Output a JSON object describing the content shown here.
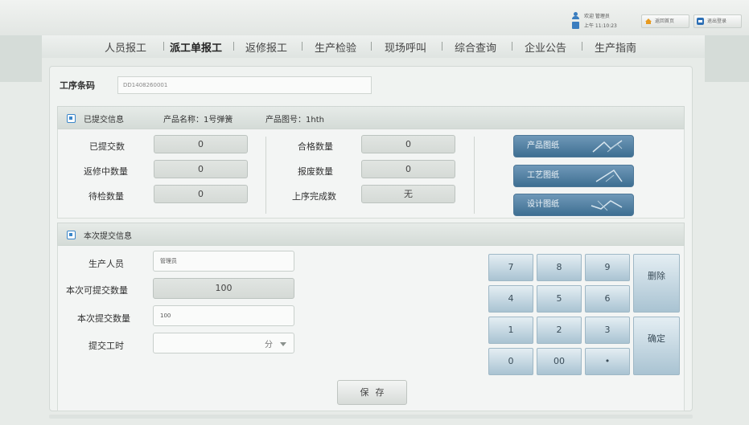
{
  "header": {
    "welcome": "欢迎 管理员",
    "time": "上午 11:10:23",
    "home_button": "返回首页",
    "exit_button": "退出登录"
  },
  "nav": {
    "items": [
      "人员报工",
      "派工单报工",
      "返修报工",
      "生产检验",
      "现场呼叫",
      "综合查询",
      "企业公告",
      "生产指南"
    ],
    "active": "派工单报工"
  },
  "barcode": {
    "label": "工序条码",
    "value": "DD1408260001"
  },
  "submitted": {
    "title": "已提交信息",
    "product_name": "产品名称：1号弹簧",
    "product_no": "产品图号：1hth",
    "fields": [
      {
        "label": "已提交数",
        "value": "0"
      },
      {
        "label": "返修中数量",
        "value": "0"
      },
      {
        "label": "待检数量",
        "value": "0"
      },
      {
        "label": "合格数量",
        "value": "0"
      },
      {
        "label": "报废数量",
        "value": "0"
      },
      {
        "label": "上序完成数",
        "value": "无"
      }
    ],
    "doc_buttons": [
      "产品图纸",
      "工艺图纸",
      "设计图纸"
    ]
  },
  "current": {
    "title": "本次提交信息",
    "producer_label": "生产人员",
    "producer_value": "管理员",
    "available_label": "本次可提交数量",
    "available_value": "100",
    "submit_qty_label": "本次提交数量",
    "submit_qty_value": "100",
    "hours_label": "提交工时",
    "hours_unit": "分"
  },
  "keypad": {
    "keys": [
      "7",
      "8",
      "9",
      "4",
      "5",
      "6",
      "1",
      "2",
      "3",
      "0",
      "00",
      "•"
    ],
    "delete": "删除",
    "confirm": "确定"
  },
  "save_label": "保存"
}
